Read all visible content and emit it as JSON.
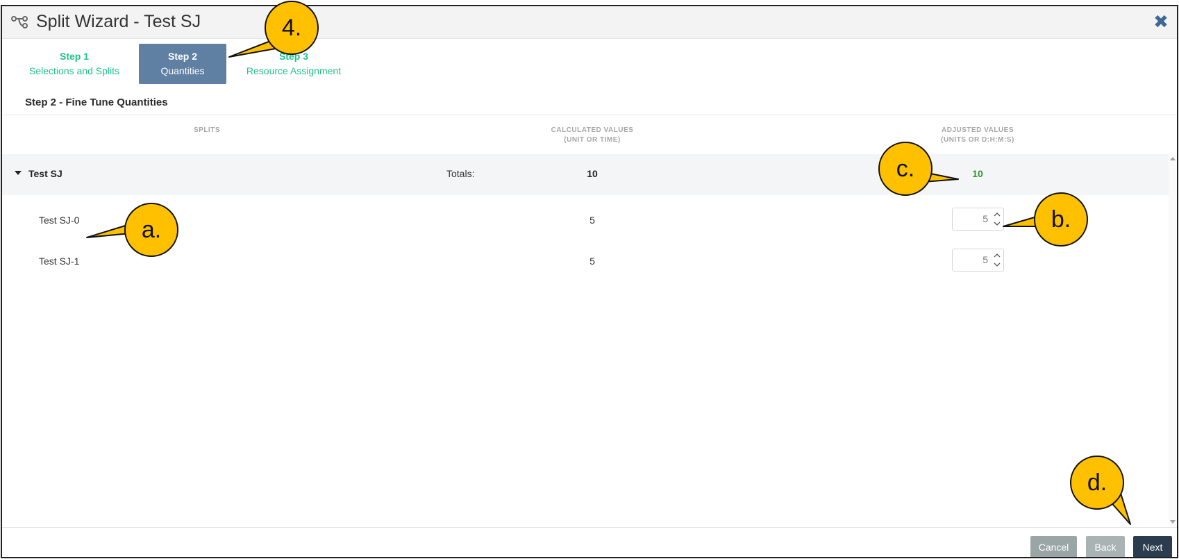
{
  "window": {
    "title": "Split Wizard - Test SJ",
    "app_icon": "split-icon",
    "close_icon": "close-icon"
  },
  "steps": [
    {
      "number": "Step 1",
      "label": "Selections and Splits"
    },
    {
      "number": "Step 2",
      "label": "Quantities"
    },
    {
      "number": "Step 3",
      "label": "Resource Assignment"
    }
  ],
  "section_title": "Step 2 - Fine Tune Quantities",
  "table": {
    "headers": {
      "splits": "SPLITS",
      "calculated": "CALCULATED VALUES",
      "calculated_sub": "(UNIT OR TIME)",
      "adjusted": "ADJUSTED VALUES",
      "adjusted_sub": "(UNITS OR D:H:M:S)"
    },
    "group": {
      "name": "Test SJ",
      "totals_label": "Totals:",
      "calculated_total": "10",
      "adjusted_total": "10"
    },
    "rows": [
      {
        "name": "Test SJ-0",
        "calculated": "5",
        "adjusted": "5"
      },
      {
        "name": "Test SJ-1",
        "calculated": "5",
        "adjusted": "5"
      }
    ]
  },
  "buttons": {
    "cancel": "Cancel",
    "back": "Back",
    "next": "Next"
  },
  "callouts": {
    "step4": "4.",
    "a": "a.",
    "b": "b.",
    "c": "c.",
    "d": "d."
  },
  "colors": {
    "accent_step": "#1fc28e",
    "active_step_bg": "#5f7fa3",
    "total_green": "#2e9a2e",
    "next_btn": "#2a3c4e",
    "callout_fill": "#ffc000"
  }
}
